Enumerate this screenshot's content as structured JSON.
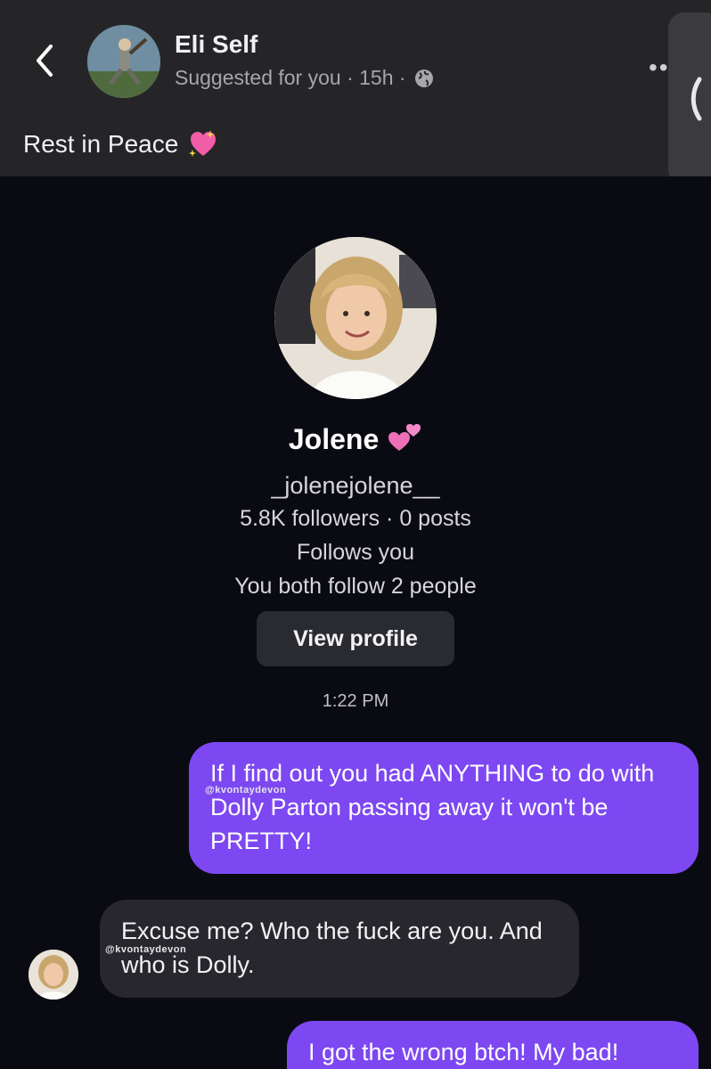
{
  "post": {
    "poster_name": "Eli Self",
    "meta": "Suggested for you · 15h ·",
    "more": "••",
    "caption": "Rest in Peace"
  },
  "profile": {
    "name": "Jolene",
    "handle": "_jolenejolene__",
    "stats": "5.8K followers · 0 posts",
    "follows_you": "Follows you",
    "mutual": "You both follow 2 people",
    "view_profile": "View profile"
  },
  "chat": {
    "timestamp": "1:22 PM",
    "watermark": "@kvontaydevon",
    "messages": [
      {
        "from": "me",
        "text": "If I find out you had ANYTHING to do with Dolly Parton passing away it won't be PRETTY!"
      },
      {
        "from": "them",
        "text": "Excuse me? Who the fuck are you. And who is Dolly."
      },
      {
        "from": "me",
        "text": "I got the wrong btch! My bad!"
      }
    ]
  },
  "icons": {
    "back": "chevron-left-icon",
    "globe": "globe-icon",
    "heart": "sparkling-heart-icon",
    "hearts": "two-hearts-icon",
    "side": "chevron-left-icon"
  },
  "colors": {
    "outgoing_bubble": "#7d48f2",
    "incoming_bubble": "#27272d",
    "screenshot_bg": "#0a0b12",
    "top_bar_bg": "#252528"
  }
}
